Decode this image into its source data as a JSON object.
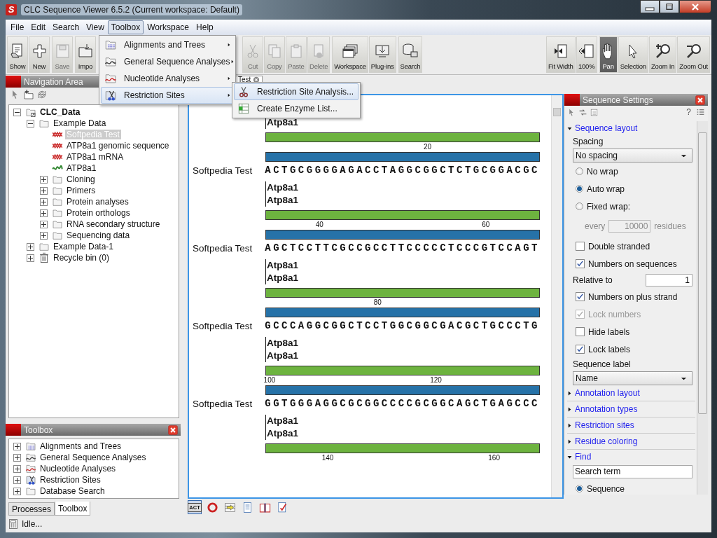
{
  "window": {
    "logo": "S",
    "title": "CLC Sequence Viewer 6.5.2 (Current workspace: Default)"
  },
  "menubar": [
    {
      "label": "File",
      "selected": false
    },
    {
      "label": "Edit",
      "selected": false
    },
    {
      "label": "Search",
      "selected": false
    },
    {
      "label": "View",
      "selected": false
    },
    {
      "label": "Toolbox",
      "selected": true
    },
    {
      "label": "Workspace",
      "selected": false
    },
    {
      "label": "Help",
      "selected": false
    }
  ],
  "toolbar": {
    "left": [
      [
        {
          "kind": "show",
          "label": "Show",
          "disabled": false
        },
        {
          "kind": "new",
          "label": "New",
          "disabled": false
        }
      ],
      [
        {
          "kind": "save",
          "label": "Save",
          "disabled": true
        }
      ],
      [
        {
          "kind": "import",
          "label": "Impo",
          "disabled": false
        }
      ],
      [
        {
          "kind": "cut",
          "label": "Cut",
          "disabled": true
        },
        {
          "kind": "copy",
          "label": "Copy",
          "disabled": true
        },
        {
          "kind": "paste",
          "label": "Paste",
          "disabled": true
        },
        {
          "kind": "delete",
          "label": "Delete",
          "disabled": true
        }
      ],
      [
        {
          "kind": "workspace",
          "label": "Workspace",
          "disabled": false
        },
        {
          "kind": "plugins",
          "label": "Plug-ins",
          "disabled": false
        }
      ],
      [
        {
          "kind": "search",
          "label": "Search",
          "disabled": false
        }
      ]
    ],
    "right": [
      [
        {
          "kind": "fitwidth",
          "label": "Fit Width",
          "selected": false
        },
        {
          "kind": "zoom100",
          "label": "100%",
          "selected": false
        }
      ],
      [
        {
          "kind": "pan",
          "label": "Pan",
          "selected": true
        },
        {
          "kind": "selection",
          "label": "Selection",
          "selected": false
        },
        {
          "kind": "zoomin",
          "label": "Zoom In",
          "selected": false
        },
        {
          "kind": "zoomout",
          "label": "Zoom Out",
          "selected": false
        }
      ]
    ]
  },
  "toolbox_menu": {
    "items": [
      {
        "kind": "alignments",
        "label": "Alignments and Trees",
        "selected": false
      },
      {
        "kind": "general",
        "label": "General Sequence Analyses",
        "selected": false
      },
      {
        "kind": "nucleotide",
        "label": "Nucleotide Analyses",
        "selected": false
      },
      {
        "kind": "restriction",
        "label": "Restriction Sites",
        "selected": true
      }
    ],
    "submenu": [
      {
        "kind": "scissors",
        "label": "Restriction Site Analysis...",
        "selected": true
      },
      {
        "kind": "enzyme",
        "label": "Create Enzyme List...",
        "selected": false
      }
    ]
  },
  "navigation_area": {
    "title": "Navigation Area",
    "tree": [
      {
        "kind": "root",
        "label": "CLC_Data",
        "expanded": true,
        "selected": false,
        "children": [
          {
            "kind": "folder",
            "label": "Example Data",
            "expanded": true,
            "selected": false,
            "children": [
              {
                "kind": "sequence",
                "label": "Softpedia Test",
                "selected": true
              },
              {
                "kind": "sequence",
                "label": "ATP8a1 genomic sequence",
                "selected": false
              },
              {
                "kind": "sequence",
                "label": "ATP8a1 mRNA",
                "selected": false
              },
              {
                "kind": "protein",
                "label": "ATP8a1",
                "selected": false
              },
              {
                "kind": "folder",
                "label": "Cloning",
                "expanded": false,
                "selected": false
              },
              {
                "kind": "folder",
                "label": "Primers",
                "expanded": false,
                "selected": false
              },
              {
                "kind": "folder",
                "label": "Protein analyses",
                "expanded": false,
                "selected": false
              },
              {
                "kind": "folder",
                "label": "Protein orthologs",
                "expanded": false,
                "selected": false
              },
              {
                "kind": "folder",
                "label": "RNA secondary structure",
                "expanded": false,
                "selected": false
              },
              {
                "kind": "folder",
                "label": "Sequencing data",
                "expanded": false,
                "selected": false
              }
            ]
          },
          {
            "kind": "folder",
            "label": "Example Data-1",
            "expanded": false,
            "selected": false
          },
          {
            "kind": "bin",
            "label": "Recycle bin (0)",
            "expanded": false,
            "selected": false
          }
        ]
      }
    ]
  },
  "toolbox_panel": {
    "title": "Toolbox",
    "tree": [
      {
        "kind": "alignments",
        "label": "Alignments and Trees",
        "expanded": false,
        "selected": false
      },
      {
        "kind": "general",
        "label": "General Sequence Analyses",
        "expanded": false,
        "selected": false
      },
      {
        "kind": "nucleotide",
        "label": "Nucleotide Analyses",
        "expanded": false,
        "selected": false
      },
      {
        "kind": "restriction",
        "label": "Restriction Sites",
        "expanded": false,
        "selected": false
      },
      {
        "kind": "folder",
        "label": "Database Search",
        "expanded": false,
        "selected": false
      }
    ],
    "tabs": [
      {
        "label": "Processes",
        "selected": false
      },
      {
        "label": "Toolbox",
        "selected": true
      }
    ]
  },
  "editor": {
    "tabs": [
      {
        "label": "Test",
        "selected": true
      }
    ],
    "blocks": [
      {
        "labels": [
          "Atp8a1"
        ],
        "ticks": [
          "20"
        ],
        "name": "Softpedia Test",
        "sequence": "ACTGCGGGGAGACCTAGGCGGCTCTGCGGACGC"
      },
      {
        "labels": [
          "Atp8a1",
          "Atp8a1"
        ],
        "ticks": [
          "40",
          "60"
        ],
        "name": "Softpedia Test",
        "sequence": "AGCTCCTTCGCCGCCTTCCCCCTCCCGTCCAGT"
      },
      {
        "labels": [
          "Atp8a1",
          "Atp8a1"
        ],
        "ticks": [
          "80"
        ],
        "name": "Softpedia Test",
        "sequence": "GCCCAGGCGGCTCCTGGCGGCGACGCTGCCCTG"
      },
      {
        "labels": [
          "Atp8a1",
          "Atp8a1"
        ],
        "ticks": [
          "100",
          "120"
        ],
        "name": "Softpedia Test",
        "sequence": "GGTGGGAGGCGCGGCCCCGCGGCAGCTGAGCCC"
      },
      {
        "labels": [
          "Atp8a1",
          "Atp8a1"
        ],
        "ticks": [
          "140",
          "160"
        ]
      }
    ],
    "view_buttons": [
      {
        "kind": "residues",
        "label": "ACT",
        "selected": true
      },
      {
        "kind": "circular",
        "selected": false
      },
      {
        "kind": "table",
        "selected": false
      },
      {
        "kind": "text",
        "selected": false
      },
      {
        "kind": "book",
        "selected": false
      },
      {
        "kind": "history",
        "selected": false
      }
    ]
  },
  "sequence_settings": {
    "title": "Sequence Settings",
    "help": "?",
    "items": [
      {
        "kind": "section",
        "label": "Sequence layout",
        "expanded": true
      },
      {
        "kind": "label",
        "label": "Spacing"
      },
      {
        "kind": "dropdown",
        "value": "No spacing"
      },
      {
        "kind": "radio",
        "label": "No wrap",
        "selected": false
      },
      {
        "kind": "radio",
        "label": "Auto wrap",
        "selected": true
      },
      {
        "kind": "radio",
        "label": "Fixed wrap:",
        "selected": false
      },
      {
        "kind": "every",
        "prefix": "every",
        "value": "10000",
        "suffix": "residues",
        "disabled": true
      },
      {
        "kind": "checkbox",
        "label": "Double stranded",
        "checked": false,
        "disabled": false
      },
      {
        "kind": "checkbox",
        "label": "Numbers on sequences",
        "checked": true,
        "disabled": false
      },
      {
        "kind": "inputrow",
        "label": "Relative to",
        "value": "1"
      },
      {
        "kind": "checkbox",
        "label": "Numbers on plus strand",
        "checked": true,
        "disabled": false
      },
      {
        "kind": "checkbox",
        "label": "Lock numbers",
        "checked": true,
        "disabled": true
      },
      {
        "kind": "checkbox",
        "label": "Hide labels",
        "checked": false,
        "disabled": false
      },
      {
        "kind": "checkbox",
        "label": "Lock labels",
        "checked": true,
        "disabled": false
      },
      {
        "kind": "label",
        "label": "Sequence label"
      },
      {
        "kind": "dropdown",
        "value": "Name"
      },
      {
        "kind": "section",
        "label": "Annotation layout",
        "expanded": false
      },
      {
        "kind": "section",
        "label": "Annotation types",
        "expanded": false
      },
      {
        "kind": "section",
        "label": "Restriction sites",
        "expanded": false
      },
      {
        "kind": "section",
        "label": "Residue coloring",
        "expanded": false
      },
      {
        "kind": "section",
        "label": "Find",
        "expanded": true
      },
      {
        "kind": "textfield",
        "value": "Search term"
      },
      {
        "kind": "radio",
        "label": "Sequence",
        "selected": true
      }
    ]
  },
  "status_bar": {
    "text": "Idle..."
  }
}
